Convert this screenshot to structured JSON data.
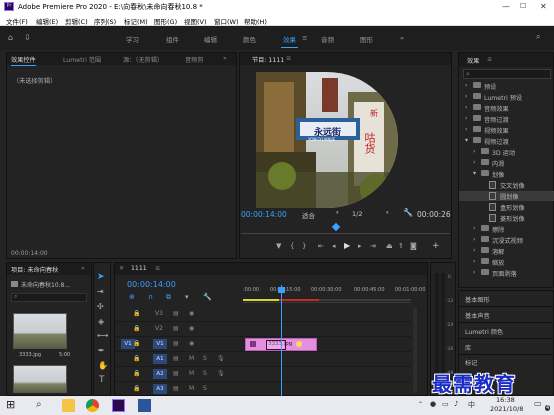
{
  "titlebar": {
    "title": "Adobe Premiere Pro 2020 - E:\\向春秋\\未命向春秋10.8 *"
  },
  "menu": [
    "文件(F)",
    "编辑(E)",
    "剪辑(C)",
    "序列(S)",
    "标记(M)",
    "图形(G)",
    "视图(V)",
    "窗口(W)",
    "帮助(H)"
  ],
  "workspaces": [
    "学习",
    "组件",
    "编辑",
    "颜色",
    "效果",
    "音频",
    "图形"
  ],
  "workspace_active": "效果",
  "left_panel": {
    "tabs": [
      "效果控件",
      "Lumetri 范围",
      "源：（无剪辑）",
      "音频剪"
    ],
    "placeholder": "（未选择剪辑）",
    "timecode": "00:00:14:00"
  },
  "program": {
    "tab": "节目: 1111",
    "timecode": "00:00:14:00",
    "fit": "适合",
    "quality": "1/2",
    "duration": "00:00:26",
    "sign_text_1": "永远街",
    "sign_text_2": "YONGYUANJIE",
    "sign_text_3": "咕货",
    "sign_text_4": "新"
  },
  "effects": {
    "tab": "效果",
    "search_placeholder": "",
    "items": [
      {
        "label": "预设",
        "kind": "folder",
        "level": 0,
        "open": false
      },
      {
        "label": "Lumetri 预设",
        "kind": "folder",
        "level": 0,
        "open": false
      },
      {
        "label": "音频效果",
        "kind": "folder",
        "level": 0,
        "open": false
      },
      {
        "label": "音频过渡",
        "kind": "folder",
        "level": 0,
        "open": false
      },
      {
        "label": "视频效果",
        "kind": "folder",
        "level": 0,
        "open": false
      },
      {
        "label": "视频过渡",
        "kind": "folder",
        "level": 0,
        "open": true
      },
      {
        "label": "3D 运动",
        "kind": "folder",
        "level": 1,
        "open": false
      },
      {
        "label": "内滑",
        "kind": "folder",
        "level": 1,
        "open": false
      },
      {
        "label": "划像",
        "kind": "folder",
        "level": 1,
        "open": true
      },
      {
        "label": "交叉划像",
        "kind": "file",
        "level": 2
      },
      {
        "label": "圆划像",
        "kind": "file",
        "level": 2,
        "selected": true
      },
      {
        "label": "盒形划像",
        "kind": "file",
        "level": 2
      },
      {
        "label": "菱形划像",
        "kind": "file",
        "level": 2
      },
      {
        "label": "擦除",
        "kind": "folder",
        "level": 1,
        "open": false
      },
      {
        "label": "沉浸式视频",
        "kind": "folder",
        "level": 1,
        "open": false
      },
      {
        "label": "溶解",
        "kind": "folder",
        "level": 1,
        "open": false
      },
      {
        "label": "缩放",
        "kind": "folder",
        "level": 1,
        "open": false
      },
      {
        "label": "页面剥落",
        "kind": "folder",
        "level": 1,
        "open": false
      }
    ],
    "bottom_panels": [
      "基本图形",
      "基本声音",
      "Lumetri 颜色",
      "库",
      "标记"
    ]
  },
  "project": {
    "tab": "项目: 未命向春秋",
    "path": "未命向春秋10.8...",
    "thumb_name": "3333.jpg",
    "thumb_duration": "5:00"
  },
  "timeline": {
    "tab": "1111",
    "timecode": "00:00:14:00",
    "ruler": [
      ":00:00",
      "00:00:15:00",
      "00:00:30:00",
      "00:00:45:00",
      "00:01:00:00"
    ],
    "video_tracks": [
      "V3",
      "V2",
      "V1"
    ],
    "audio_tracks": [
      "A1",
      "A2",
      "A3"
    ],
    "source_v": "V1",
    "source_a": "A1",
    "clip_label": "3333.jpg",
    "clip_color": "#e58fe3",
    "db_labels": [
      "0",
      "-12",
      "-24",
      "-36",
      "-48",
      "dB"
    ]
  },
  "taskbar": {
    "time": "16:38",
    "date": "2021/10/8",
    "lang": "中",
    "notif": "4"
  },
  "watermark": "最需教育",
  "colors": {
    "accent": "#3aa0ff",
    "panel": "#232323",
    "clip": "#e58fe3",
    "playhead": "#3aa0ff"
  }
}
